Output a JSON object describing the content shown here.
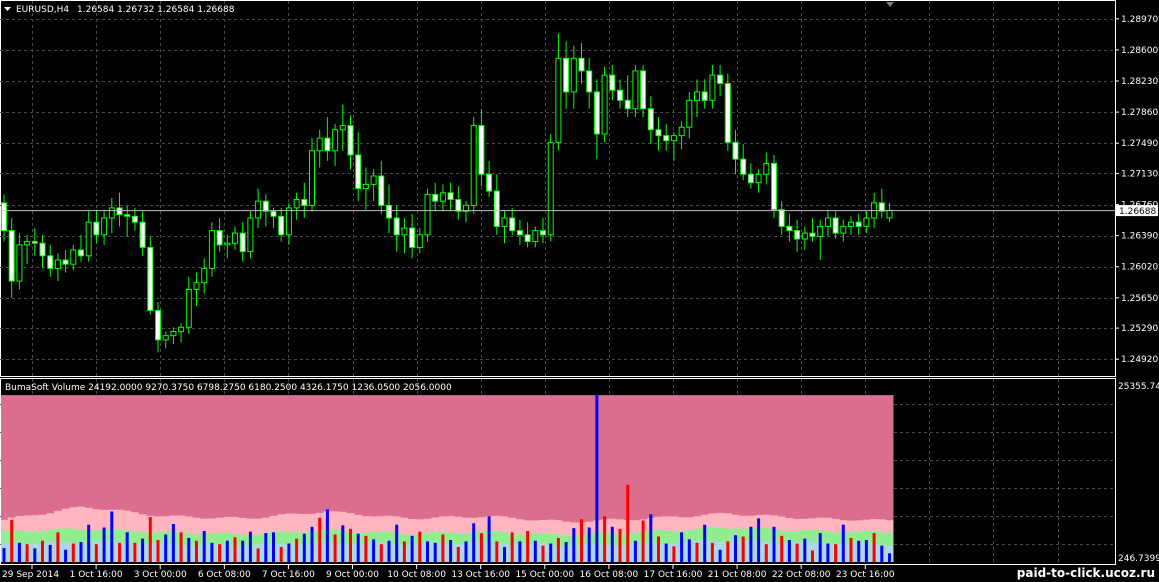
{
  "header": {
    "symbol_label": "EURUSD,H4",
    "ohlc": "1.26584 1.26732 1.26584 1.26688"
  },
  "price_axis": {
    "ticks": [
      "1.28970",
      "1.28600",
      "1.28230",
      "1.27860",
      "1.27490",
      "1.27130",
      "1.26760",
      "1.26390",
      "1.26020",
      "1.25650",
      "1.25290",
      "1.24920"
    ],
    "current_price": "1.26688"
  },
  "indicator": {
    "title": "BumaSoft Volume 24192.0000 9270.3750 6798.2750 6180.2500 4326.1750 1236.0500 2056.0000",
    "scale_max": "25355.74",
    "scale_min": "246.7399"
  },
  "time_axis": {
    "ticks": [
      "29 Sep 2014",
      "1 Oct 16:00",
      "3 Oct 00:00",
      "6 Oct 08:00",
      "7 Oct 16:00",
      "9 Oct 00:00",
      "10 Oct 08:00",
      "13 Oct 16:00",
      "15 Oct 00:00",
      "16 Oct 08:00",
      "17 Oct 16:00",
      "21 Oct 08:00",
      "22 Oct 08:00",
      "23 Oct 16:00"
    ]
  },
  "watermark": "paid-to-click.ucoz.ru",
  "colors": {
    "background": "#000000",
    "grid": "#4a4a4a",
    "candle": "#00ff00",
    "bull_volume": "#0000ff",
    "bear_volume": "#ff0000",
    "band_1": "#db6e8e",
    "band_2": "#ffb6c1",
    "band_3": "#90ee90",
    "band_4": "#add8e6"
  },
  "chart_data": [
    {
      "type": "candlestick",
      "series": "EURUSD,H4",
      "ylim": [
        1.2472,
        1.2917
      ],
      "candles": [
        [
          1.2678,
          1.2688,
          1.2632,
          1.2645
        ],
        [
          1.2645,
          1.266,
          1.2565,
          1.2585
        ],
        [
          1.2585,
          1.2642,
          1.2575,
          1.2628
        ],
        [
          1.2628,
          1.264,
          1.2605,
          1.2632
        ],
        [
          1.2632,
          1.2648,
          1.2615,
          1.263
        ],
        [
          1.263,
          1.264,
          1.26,
          1.2615
        ],
        [
          1.2615,
          1.2628,
          1.259,
          1.26
        ],
        [
          1.26,
          1.2618,
          1.2585,
          1.261
        ],
        [
          1.261,
          1.2622,
          1.2595,
          1.2605
        ],
        [
          1.2605,
          1.2628,
          1.2598,
          1.2622
        ],
        [
          1.2622,
          1.264,
          1.2608,
          1.2615
        ],
        [
          1.2615,
          1.2668,
          1.2608,
          1.2655
        ],
        [
          1.2655,
          1.267,
          1.263,
          1.264
        ],
        [
          1.264,
          1.2668,
          1.2628,
          1.266
        ],
        [
          1.266,
          1.2684,
          1.2642,
          1.2672
        ],
        [
          1.2672,
          1.269,
          1.265,
          1.2664
        ],
        [
          1.2664,
          1.2675,
          1.2638,
          1.2662
        ],
        [
          1.2662,
          1.2672,
          1.2645,
          1.2655
        ],
        [
          1.2655,
          1.2668,
          1.2615,
          1.2625
        ],
        [
          1.2625,
          1.2638,
          1.2545,
          1.255
        ],
        [
          1.255,
          1.256,
          1.25,
          1.2515
        ],
        [
          1.2515,
          1.2525,
          1.2505,
          1.252
        ],
        [
          1.252,
          1.253,
          1.251,
          1.2525
        ],
        [
          1.2525,
          1.2535,
          1.2512,
          1.253
        ],
        [
          1.253,
          1.259,
          1.2522,
          1.2575
        ],
        [
          1.2575,
          1.2595,
          1.2555,
          1.2583
        ],
        [
          1.2583,
          1.2612,
          1.257,
          1.26
        ],
        [
          1.26,
          1.2655,
          1.259,
          1.2645
        ],
        [
          1.2645,
          1.266,
          1.262,
          1.2628
        ],
        [
          1.2628,
          1.264,
          1.2612,
          1.263
        ],
        [
          1.263,
          1.265,
          1.2622,
          1.2642
        ],
        [
          1.2642,
          1.2655,
          1.2608,
          1.262
        ],
        [
          1.262,
          1.2668,
          1.2612,
          1.266
        ],
        [
          1.266,
          1.2695,
          1.2648,
          1.268
        ],
        [
          1.268,
          1.2688,
          1.265,
          1.2668
        ],
        [
          1.2668,
          1.2672,
          1.2648,
          1.2662
        ],
        [
          1.2662,
          1.2672,
          1.2632,
          1.264
        ],
        [
          1.264,
          1.2678,
          1.2628,
          1.2672
        ],
        [
          1.2672,
          1.269,
          1.2658,
          1.2682
        ],
        [
          1.2682,
          1.2702,
          1.266,
          1.2675
        ],
        [
          1.2675,
          1.2755,
          1.2668,
          1.274
        ],
        [
          1.274,
          1.2765,
          1.272,
          1.2755
        ],
        [
          1.2755,
          1.278,
          1.2728,
          1.274
        ],
        [
          1.274,
          1.2772,
          1.2722,
          1.2765
        ],
        [
          1.2765,
          1.2795,
          1.274,
          1.277
        ],
        [
          1.277,
          1.2782,
          1.2718,
          1.2735
        ],
        [
          1.2735,
          1.2762,
          1.268,
          1.2695
        ],
        [
          1.2695,
          1.272,
          1.267,
          1.27
        ],
        [
          1.27,
          1.2718,
          1.268,
          1.271
        ],
        [
          1.271,
          1.2728,
          1.2665,
          1.2675
        ],
        [
          1.2675,
          1.27,
          1.2642,
          1.266
        ],
        [
          1.266,
          1.2675,
          1.262,
          1.264
        ],
        [
          1.264,
          1.266,
          1.2618,
          1.2648
        ],
        [
          1.2648,
          1.2665,
          1.2612,
          1.2625
        ],
        [
          1.2625,
          1.2648,
          1.2618,
          1.264
        ],
        [
          1.264,
          1.2695,
          1.2632,
          1.2688
        ],
        [
          1.2688,
          1.2702,
          1.2668,
          1.268
        ],
        [
          1.268,
          1.27,
          1.2668,
          1.269
        ],
        [
          1.269,
          1.2702,
          1.2668,
          1.2682
        ],
        [
          1.2682,
          1.2698,
          1.2658,
          1.2668
        ],
        [
          1.2668,
          1.268,
          1.2655,
          1.2675
        ],
        [
          1.2675,
          1.278,
          1.2665,
          1.277
        ],
        [
          1.277,
          1.279,
          1.2698,
          1.2712
        ],
        [
          1.2712,
          1.2728,
          1.2685,
          1.2692
        ],
        [
          1.2692,
          1.2712,
          1.264,
          1.265
        ],
        [
          1.265,
          1.2668,
          1.263,
          1.266
        ],
        [
          1.266,
          1.2672,
          1.264,
          1.2645
        ],
        [
          1.2645,
          1.2658,
          1.2628,
          1.264
        ],
        [
          1.264,
          1.2655,
          1.2625,
          1.2632
        ],
        [
          1.2632,
          1.265,
          1.2625,
          1.2645
        ],
        [
          1.2645,
          1.266,
          1.263,
          1.264
        ],
        [
          1.264,
          1.276,
          1.2632,
          1.275
        ],
        [
          1.275,
          1.288,
          1.274,
          1.285
        ],
        [
          1.285,
          1.287,
          1.279,
          1.281
        ],
        [
          1.281,
          1.2865,
          1.279,
          1.285
        ],
        [
          1.285,
          1.2868,
          1.282,
          1.2835
        ],
        [
          1.2835,
          1.285,
          1.279,
          1.281
        ],
        [
          1.281,
          1.2825,
          1.273,
          1.276
        ],
        [
          1.276,
          1.284,
          1.275,
          1.283
        ],
        [
          1.283,
          1.2842,
          1.28,
          1.2812
        ],
        [
          1.2812,
          1.2825,
          1.279,
          1.28
        ],
        [
          1.28,
          1.283,
          1.278,
          1.279
        ],
        [
          1.279,
          1.2842,
          1.278,
          1.2835
        ],
        [
          1.2835,
          1.2842,
          1.278,
          1.279
        ],
        [
          1.279,
          1.2805,
          1.2748,
          1.2765
        ],
        [
          1.2765,
          1.278,
          1.274,
          1.2758
        ],
        [
          1.2758,
          1.2772,
          1.274,
          1.2752
        ],
        [
          1.2752,
          1.2762,
          1.2728,
          1.2758
        ],
        [
          1.2758,
          1.2775,
          1.2742,
          1.2768
        ],
        [
          1.2768,
          1.281,
          1.2755,
          1.28
        ],
        [
          1.28,
          1.2825,
          1.278,
          1.281
        ],
        [
          1.281,
          1.2825,
          1.279,
          1.28
        ],
        [
          1.28,
          1.2842,
          1.279,
          1.283
        ],
        [
          1.283,
          1.2842,
          1.2805,
          1.282
        ],
        [
          1.282,
          1.2832,
          1.274,
          1.275
        ],
        [
          1.275,
          1.2765,
          1.2712,
          1.273
        ],
        [
          1.273,
          1.2748,
          1.2705,
          1.2712
        ],
        [
          1.2712,
          1.2725,
          1.2695,
          1.2702
        ],
        [
          1.2702,
          1.2718,
          1.269,
          1.2712
        ],
        [
          1.2712,
          1.2738,
          1.27,
          1.2725
        ],
        [
          1.2725,
          1.2735,
          1.266,
          1.267
        ],
        [
          1.267,
          1.268,
          1.264,
          1.265
        ],
        [
          1.265,
          1.2665,
          1.2632,
          1.2645
        ],
        [
          1.2645,
          1.2658,
          1.262,
          1.2635
        ],
        [
          1.2635,
          1.265,
          1.2622,
          1.2642
        ],
        [
          1.2642,
          1.266,
          1.2632,
          1.2638
        ],
        [
          1.2638,
          1.2658,
          1.261,
          1.265
        ],
        [
          1.265,
          1.267,
          1.2638,
          1.266
        ],
        [
          1.266,
          1.2668,
          1.2635,
          1.2642
        ],
        [
          1.2642,
          1.2658,
          1.2632,
          1.265
        ],
        [
          1.265,
          1.2662,
          1.264,
          1.2655
        ],
        [
          1.2655,
          1.2665,
          1.264,
          1.265
        ],
        [
          1.265,
          1.2668,
          1.2642,
          1.266
        ],
        [
          1.266,
          1.269,
          1.2648,
          1.2678
        ],
        [
          1.2678,
          1.2695,
          1.266,
          1.2668
        ],
        [
          1.266,
          1.2678,
          1.2655,
          1.2669
        ]
      ]
    },
    {
      "type": "bar",
      "series": "BumaSoft Volume",
      "ylim": [
        246.7399,
        25355.74
      ],
      "volume": [
        2260,
        6300,
        3000,
        2800,
        2200,
        3300,
        2700,
        4500,
        2000,
        2900,
        3100,
        5600,
        2800,
        5200,
        7500,
        3000,
        4500,
        3000,
        3600,
        6700,
        3400,
        4200,
        5700,
        4500,
        3700,
        3300,
        4700,
        3000,
        2800,
        3300,
        3800,
        3300,
        4600,
        2200,
        4400,
        4500,
        2400,
        2900,
        3600,
        4300,
        5300,
        6600,
        7800,
        4200,
        5500,
        5000,
        4300,
        4000,
        3500,
        2800,
        3300,
        5600,
        3200,
        4000,
        4600,
        3200,
        3000,
        4200,
        3400,
        2400,
        3200,
        5800,
        4400,
        6800,
        3200,
        2400,
        4500,
        3200,
        4700,
        3300,
        2600,
        2900,
        3700,
        3100,
        5100,
        6400,
        5200,
        24192,
        6800,
        5300,
        5000,
        11300,
        3300,
        6200,
        7100,
        3900,
        2900,
        2500,
        4500,
        3500,
        3000,
        5600,
        3000,
        2000,
        3200,
        4100,
        3900,
        5300,
        6500,
        2800,
        5300,
        4000,
        3400,
        2900,
        3600,
        1900,
        4400,
        2900,
        2800,
        5600,
        3700,
        3300,
        3400,
        4400,
        2600,
        1500
      ],
      "bull": [
        true,
        false,
        true,
        false,
        true,
        false,
        true,
        false,
        true,
        false,
        true,
        true,
        false,
        true,
        true,
        false,
        true,
        false,
        true,
        false,
        false,
        true,
        true,
        false,
        true,
        false,
        true,
        true,
        false,
        true,
        false,
        true,
        true,
        false,
        true,
        true,
        false,
        true,
        false,
        true,
        true,
        false,
        true,
        false,
        true,
        false,
        true,
        false,
        true,
        false,
        true,
        true,
        false,
        true,
        false,
        true,
        true,
        false,
        true,
        false,
        true,
        true,
        false,
        true,
        false,
        true,
        false,
        true,
        false,
        true,
        false,
        true,
        false,
        true,
        true,
        false,
        true,
        true,
        false,
        true,
        false,
        false,
        true,
        false,
        true,
        false,
        true,
        false,
        true,
        true,
        false,
        true,
        false,
        true,
        false,
        true,
        false,
        true,
        true,
        false,
        true,
        false,
        true,
        false,
        true,
        false,
        true,
        true,
        false,
        true,
        false,
        true,
        true,
        false,
        true,
        true
      ],
      "bands": [
        {
          "name": "band_1",
          "color": "#db6e8e",
          "value": 24192
        },
        {
          "name": "band_2",
          "color": "#ffb6c1",
          "values_trend": [
            6300,
            8200,
            6800,
            6500,
            7500,
            6500,
            6800,
            6000,
            6500,
            7200,
            6500,
            6200
          ]
        },
        {
          "name": "band_3",
          "color": "#90ee90",
          "values_trend": [
            4600,
            5000,
            4500,
            4200,
            4800,
            4300,
            4600,
            4100,
            4600,
            5200,
            4700,
            4500
          ]
        },
        {
          "name": "band_4",
          "color": "#add8e6",
          "values_trend": [
            2800,
            3200,
            2800,
            2600,
            3000,
            2800,
            3000,
            2600,
            2900,
            3300,
            3000,
            2800
          ]
        }
      ]
    }
  ]
}
